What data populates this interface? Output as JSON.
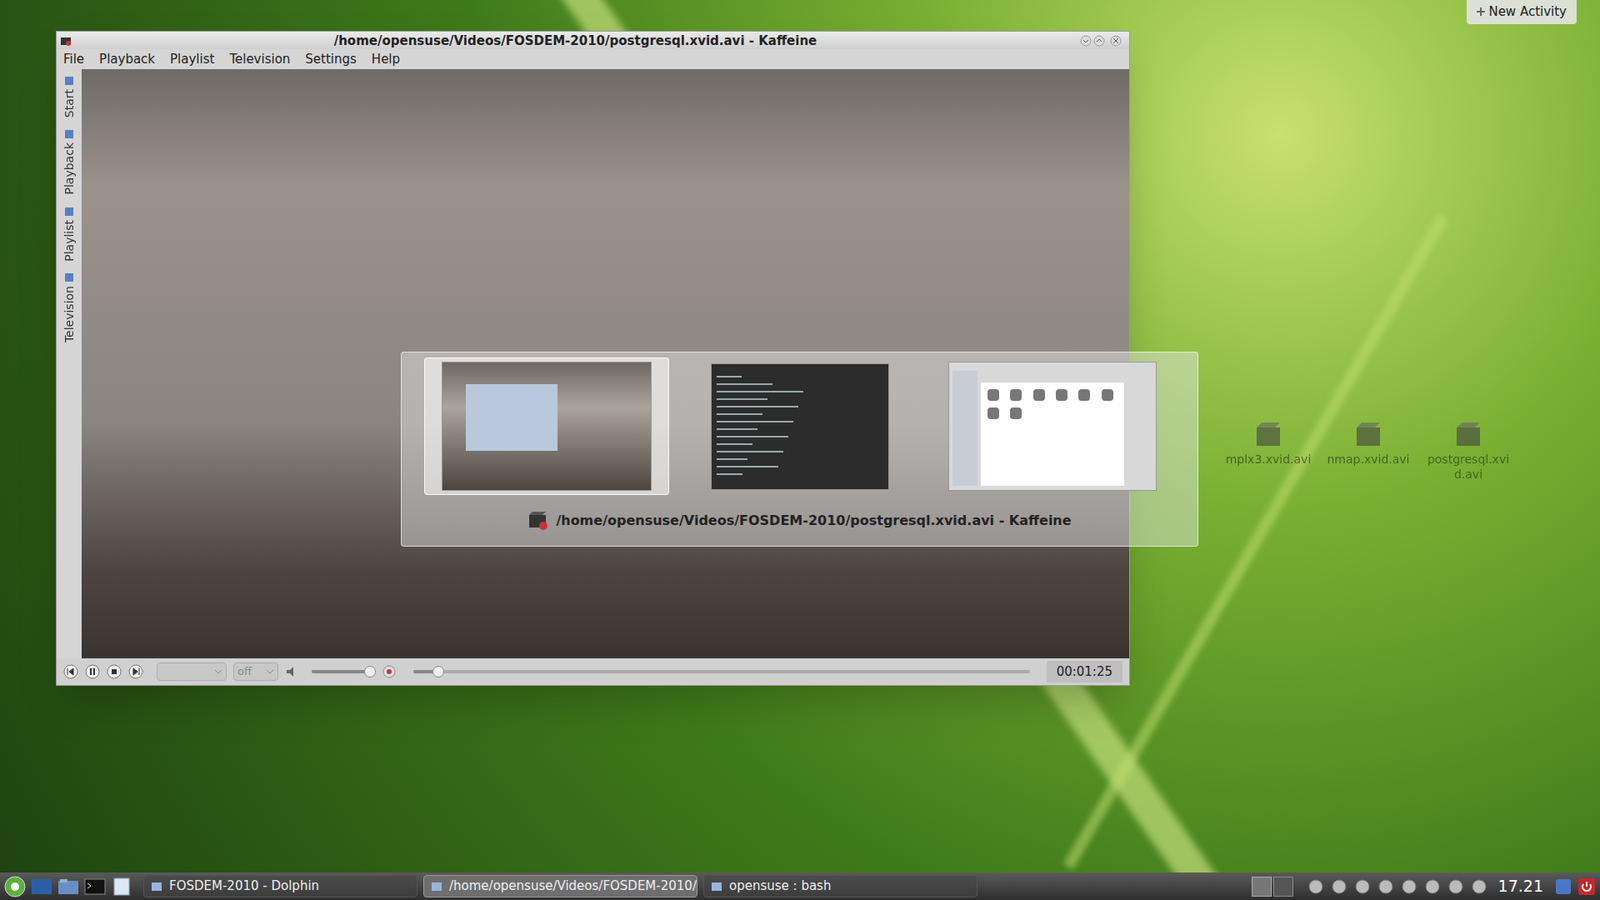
{
  "activity_button": "New Activity",
  "window": {
    "title": "/home/opensuse/Videos/FOSDEM-2010/postgresql.xvid.avi - Kaffeine",
    "menu": [
      "File",
      "Playback",
      "Playlist",
      "Television",
      "Settings",
      "Help"
    ],
    "side_tabs": [
      "Start",
      "Playback",
      "Playlist",
      "Television"
    ],
    "controls": {
      "source": "",
      "subtitle": "off",
      "volume": {
        "level": 0.92
      },
      "seek": {
        "level": 0.04
      },
      "time": "00:01:25"
    }
  },
  "switcher": {
    "windows": [
      {
        "kind": "video",
        "selected": true
      },
      {
        "kind": "terminal",
        "selected": false
      },
      {
        "kind": "files",
        "selected": false
      }
    ],
    "caption": "/home/opensuse/Videos/FOSDEM-2010/postgresql.xvid.avi - Kaffeine"
  },
  "desktop_icons": [
    "mplx3.xvid.avi",
    "nmap.xvid.avi",
    "postgresql.xvid.avi"
  ],
  "taskbar": {
    "tasks": [
      {
        "label": "FOSDEM-2010 - Dolphin",
        "selected": false
      },
      {
        "label": "/home/opensuse/Videos/FOSDEM-2010/",
        "selected": true
      },
      {
        "label": "opensuse : bash",
        "selected": false
      }
    ],
    "clock": "17.21"
  }
}
